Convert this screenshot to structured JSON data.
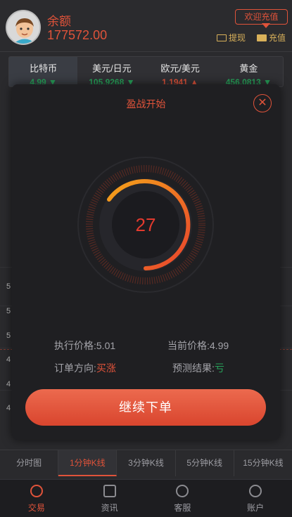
{
  "header": {
    "balance_label": "余额",
    "balance_value": "177572.00",
    "welcome_label": "欢迎充值",
    "withdraw_label": "提现",
    "recharge_label": "充值"
  },
  "tickers": [
    {
      "name": "比特币",
      "price": "4.99",
      "dir": "down-arrow-icon"
    },
    {
      "name": "美元/日元",
      "price": "105.9268",
      "dir": "down-arrow-icon"
    },
    {
      "name": "欧元/美元",
      "price": "1.1941",
      "dir": "up-arrow-icon"
    },
    {
      "name": "黄金",
      "price": "456.0813",
      "dir": "down-arrow-icon"
    }
  ],
  "chart_axis": [
    "5",
    "5",
    "5",
    "4",
    "4",
    "4"
  ],
  "modal": {
    "title": "盈战开始",
    "countdown": "27",
    "exec_price_label": "执行价格:",
    "exec_price": "5.01",
    "current_price_label": "当前价格:",
    "current_price": "4.99",
    "direction_label": "订单方向:",
    "direction": "买涨",
    "result_label": "预测结果:",
    "result": "亏",
    "continue_label": "继续下单"
  },
  "periods": [
    "分时图",
    "1分钟K线",
    "3分钟K线",
    "5分钟K线",
    "15分钟K线"
  ],
  "nav": [
    {
      "label": "交易",
      "icon": "trade-icon"
    },
    {
      "label": "资讯",
      "icon": "news-icon"
    },
    {
      "label": "客服",
      "icon": "service-icon"
    },
    {
      "label": "账户",
      "icon": "account-icon"
    }
  ],
  "colors": {
    "accent": "#e0533a",
    "up": "#27a35a",
    "gold": "#d9b15a"
  }
}
